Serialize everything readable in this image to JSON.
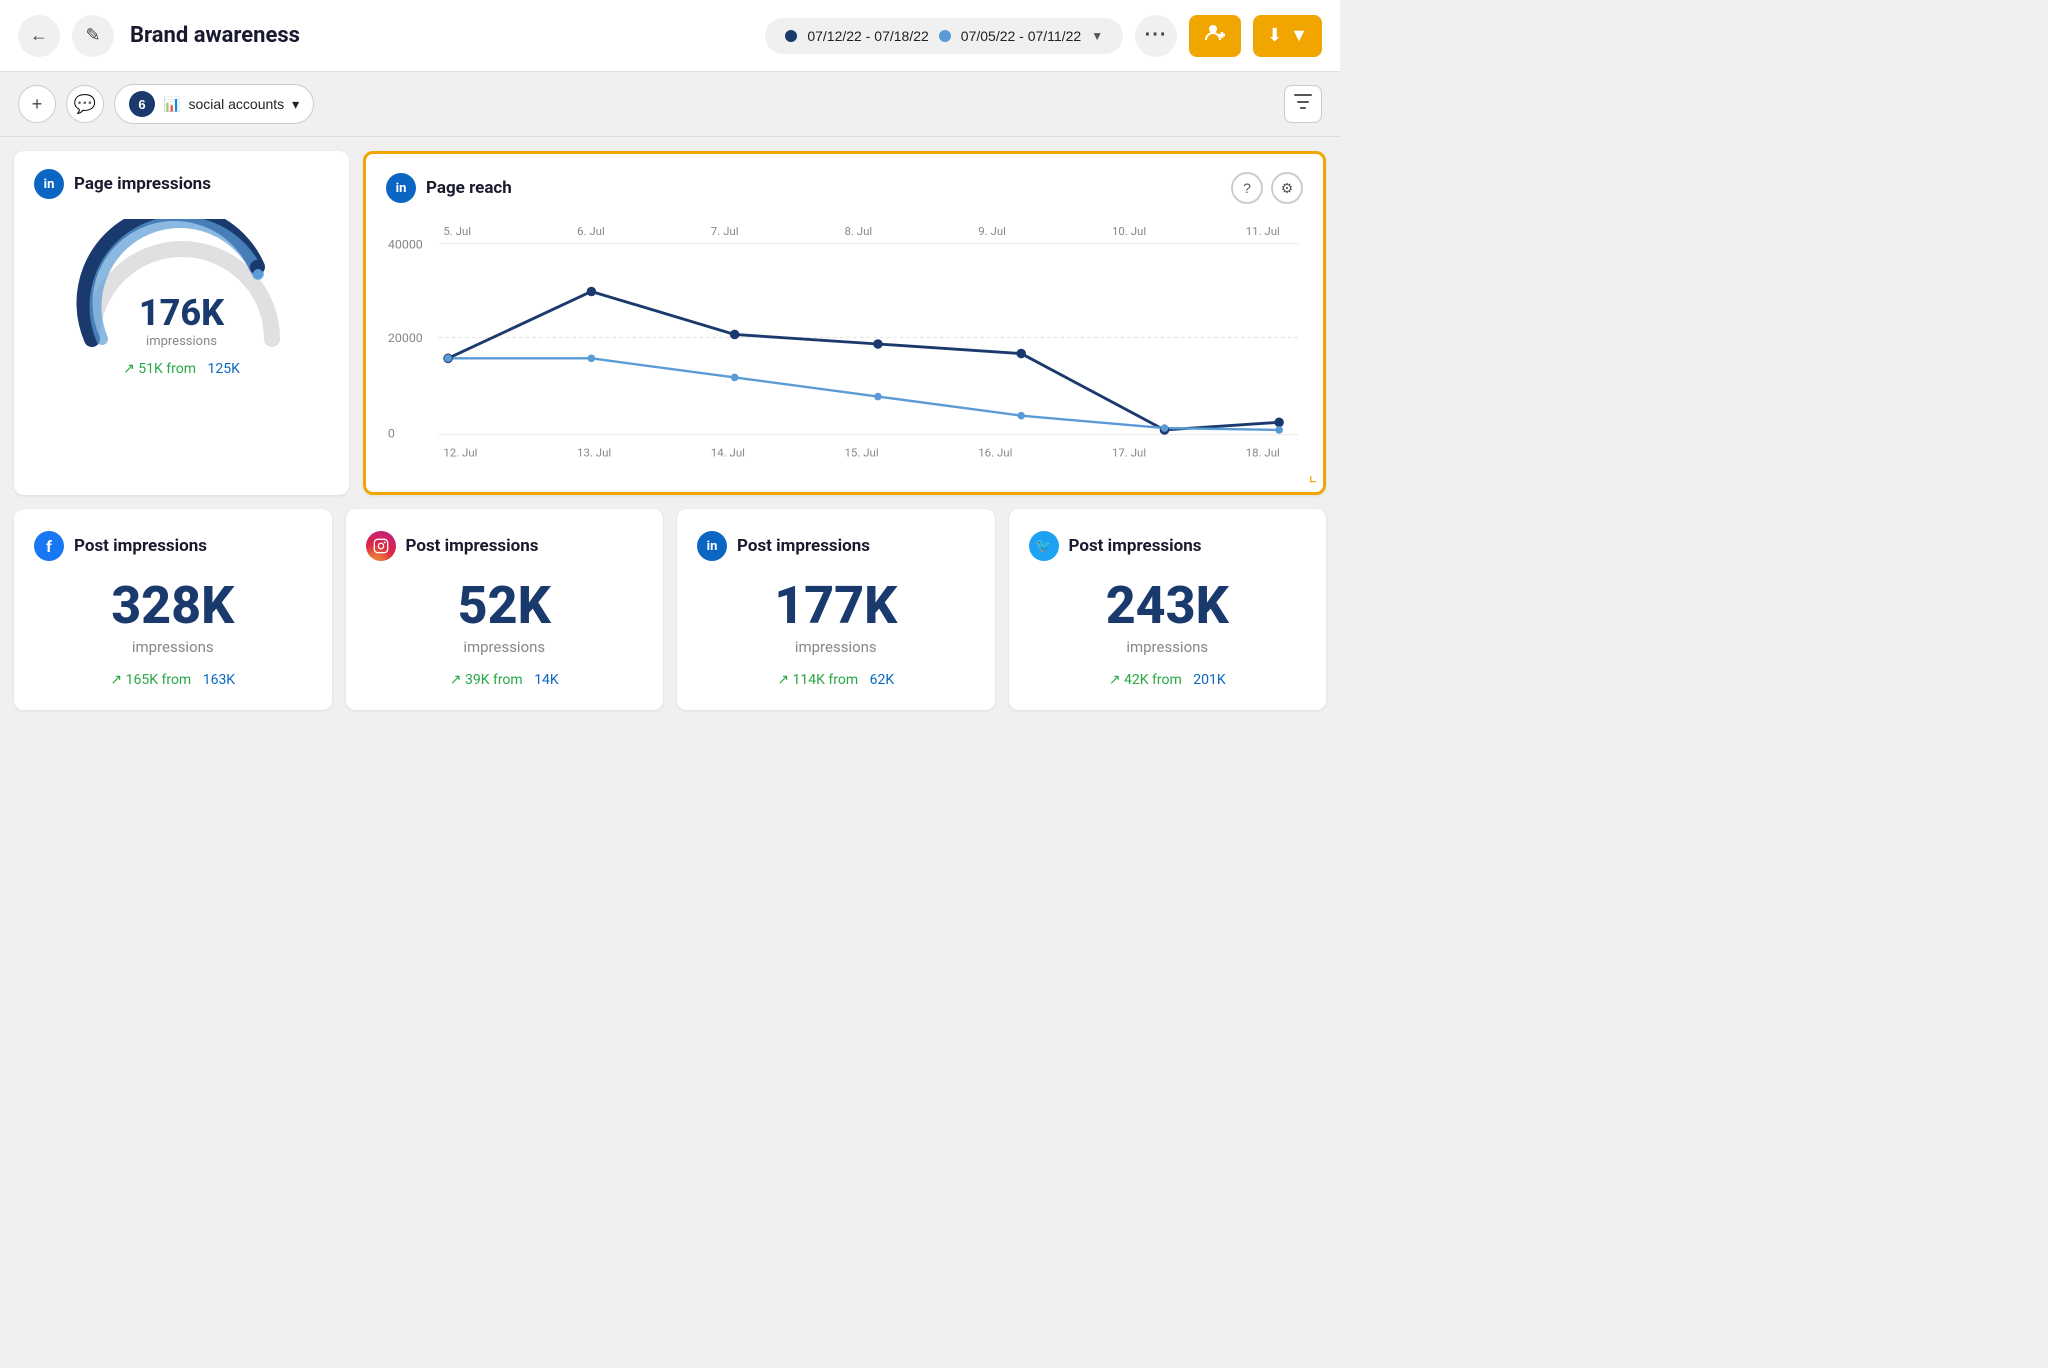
{
  "header": {
    "title": "Brand awareness",
    "date_range_primary": "07/12/22 - 07/18/22",
    "date_range_secondary": "07/05/22 - 07/11/22",
    "back_label": "←",
    "edit_label": "✎",
    "more_label": "···",
    "add_user_label": "👤+",
    "download_label": "⬇"
  },
  "subheader": {
    "add_label": "+",
    "comment_label": "💬",
    "social_count": "6",
    "social_label": "social accounts",
    "filter_label": "▼"
  },
  "page_impressions": {
    "title": "Page impressions",
    "value": "176K",
    "unit": "impressions",
    "change": "↗ 51K from",
    "from_value": "125K"
  },
  "page_reach": {
    "title": "Page reach",
    "x_labels_top": [
      "5. Jul",
      "6. Jul",
      "7. Jul",
      "8. Jul",
      "9. Jul",
      "10. Jul",
      "11. Jul"
    ],
    "x_labels_bottom": [
      "12. Jul",
      "13. Jul",
      "14. Jul",
      "15. Jul",
      "16. Jul",
      "17. Jul",
      "18. Jul"
    ],
    "y_labels": [
      "40000",
      "20000",
      "0"
    ],
    "series1": [
      16000,
      30000,
      21000,
      19000,
      17000,
      1000,
      2500
    ],
    "series2": [
      16000,
      16000,
      12000,
      8000,
      4000,
      1500,
      1000
    ]
  },
  "bottom_cards": [
    {
      "platform": "facebook",
      "title": "Post impressions",
      "value": "328K",
      "unit": "impressions",
      "change": "↗ 165K from",
      "from_value": "163K"
    },
    {
      "platform": "instagram",
      "title": "Post impressions",
      "value": "52K",
      "unit": "impressions",
      "change": "↗ 39K from",
      "from_value": "14K"
    },
    {
      "platform": "linkedin",
      "title": "Post impressions",
      "value": "177K",
      "unit": "impressions",
      "change": "↗ 114K from",
      "from_value": "62K"
    },
    {
      "platform": "twitter",
      "title": "Post impressions",
      "value": "243K",
      "unit": "impressions",
      "change": "↗ 42K from",
      "from_value": "201K"
    }
  ],
  "icons": {
    "bar_chart": "📊",
    "question": "?",
    "gear": "⚙",
    "filter": "⊟"
  }
}
